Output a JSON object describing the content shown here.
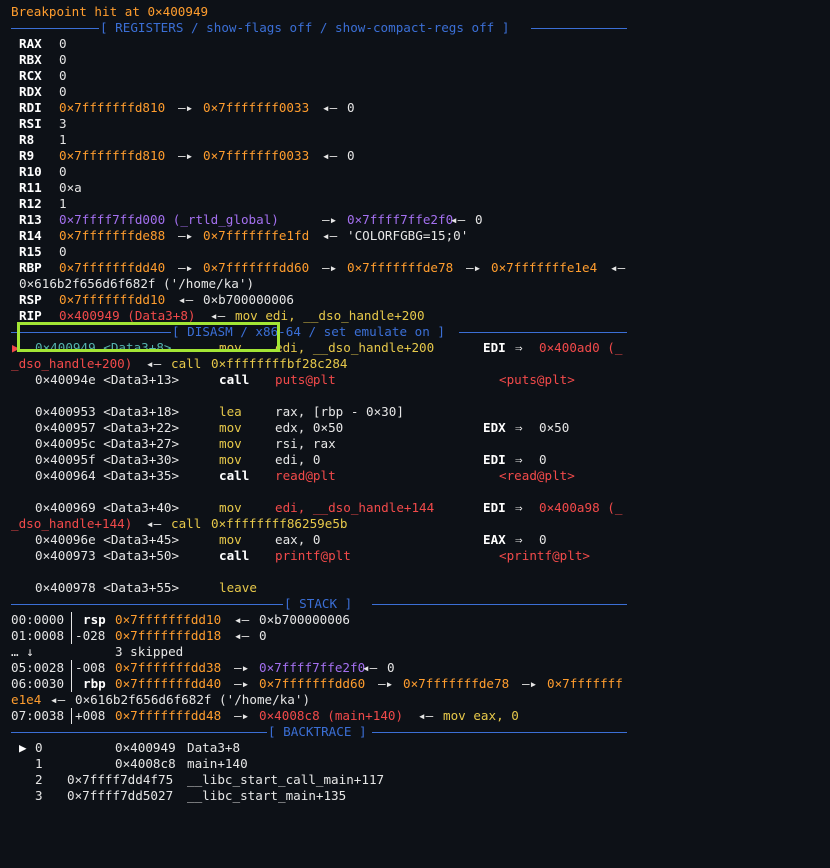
{
  "breakpoint": "Breakpoint hit at 0×400949",
  "sections": {
    "registers": "[ REGISTERS / show-flags off / show-compact-regs off ]",
    "disasm": "[ DISASM / x86-64 / set emulate on ]",
    "stack": "[ STACK ]",
    "backtrace": "[ BACKTRACE ]"
  },
  "registers": [
    {
      "name": "RAX",
      "val": "0"
    },
    {
      "name": "RBX",
      "val": "0"
    },
    {
      "name": "RCX",
      "val": "0"
    },
    {
      "name": "RDX",
      "val": "0"
    },
    {
      "name": "RDI",
      "addr": "0×7fffffffd810",
      "arrow": "—▸",
      "target": "0×7fffffff0033",
      "larrow": "◂—",
      "deref": "0"
    },
    {
      "name": "RSI",
      "val": "3"
    },
    {
      "name": "R8",
      "val": "1"
    },
    {
      "name": "R9",
      "addr": "0×7fffffffd810",
      "arrow": "—▸",
      "target": "0×7fffffff0033",
      "larrow": "◂—",
      "deref": "0"
    },
    {
      "name": "R10",
      "val": "0"
    },
    {
      "name": "R11",
      "val": "0×a"
    },
    {
      "name": "R12",
      "val": "1"
    },
    {
      "name": "R13",
      "addr": "0×7ffff7ffd000 (_rtld_global)",
      "arrow": "—▸",
      "target": "0×7ffff7ffe2f0",
      "larrow": "◂—",
      "deref": "0"
    },
    {
      "name": "R14",
      "addr": "0×7fffffffde88",
      "arrow": "—▸",
      "target": "0×7fffffffe1fd",
      "larrow": "◂—",
      "deref": "'COLORFGBG=15;0'"
    },
    {
      "name": "R15",
      "val": "0"
    },
    {
      "name": "RBP",
      "addr": "0×7fffffffdd40",
      "a1": "—▸",
      "t1": "0×7fffffffdd60",
      "a2": "—▸",
      "t2": "0×7fffffffde78",
      "a3": "—▸",
      "t3": "0×7fffffffe1e4",
      "a4": "◂—",
      "cont": "0×616b2f656d6f682f ('/home/ka')"
    },
    {
      "name": "RSP",
      "addr": "0×7fffffffdd10",
      "larrow": "◂—",
      "deref": "0×b700000006"
    },
    {
      "name": "RIP",
      "addr": "0×400949 (Data3+8)",
      "larrow": "◂—",
      "instr": "mov edi, __dso_handle+200"
    }
  ],
  "disasm": {
    "current": {
      "marker": "▶",
      "addr": "0×400949 <Data3+8>",
      "mnem": "mov",
      "ops": "edi, __dso_handle+200",
      "reg": "EDI",
      "arrow": "⇒",
      "res": "0×400ad0 (_",
      "cont": "_dso_handle+200)",
      "carrow": "◂—",
      "ccall": "call",
      "ctarget": "0×ffffffffbf28c284"
    },
    "rows": [
      {
        "addr": "0×40094e <Data3+13>",
        "mnem": "call",
        "ops": "puts@plt",
        "comment": "<puts@plt>"
      },
      {
        "addr": "0×400953 <Data3+18>",
        "mnem": "lea",
        "ops": "rax, [rbp - 0×30]"
      },
      {
        "addr": "0×400957 <Data3+22>",
        "mnem": "mov",
        "ops": "edx, 0×50",
        "reg": "EDX",
        "arrow": "⇒",
        "res": "0×50"
      },
      {
        "addr": "0×40095c <Data3+27>",
        "mnem": "mov",
        "ops": "rsi, rax"
      },
      {
        "addr": "0×40095f <Data3+30>",
        "mnem": "mov",
        "ops": "edi, 0",
        "reg": "EDI",
        "arrow": "⇒",
        "res": "0"
      },
      {
        "addr": "0×400964 <Data3+35>",
        "mnem": "call",
        "ops": "read@plt",
        "comment": "<read@plt>"
      },
      {
        "addr": "0×400969 <Data3+40>",
        "mnem": "mov",
        "ops": "edi, __dso_handle+144",
        "reg": "EDI",
        "arrow": "⇒",
        "res": "0×400a98 (_",
        "cont": "_dso_handle+144)",
        "carrow": "◂—",
        "ccall": "call",
        "ctarget": "0×ffffffff86259e5b"
      },
      {
        "addr": "0×40096e <Data3+45>",
        "mnem": "mov",
        "ops": "eax, 0",
        "reg": "EAX",
        "arrow": "⇒",
        "res": "0"
      },
      {
        "addr": "0×400973 <Data3+50>",
        "mnem": "call",
        "ops": "printf@plt",
        "comment": "<printf@plt>"
      },
      {
        "addr": "0×400978 <Data3+55>",
        "mnem": "leave",
        "ops": ""
      }
    ]
  },
  "stack": [
    {
      "idx": "00:0000",
      "reg": "rsp",
      "addr": "0×7fffffffdd10",
      "larrow": "◂—",
      "val": "0×b700000006"
    },
    {
      "idx": "01:0008",
      "off": "-028",
      "addr": "0×7fffffffdd18",
      "larrow": "◂—",
      "val": "0"
    },
    {
      "dots": "… ↓",
      "skip": "3 skipped"
    },
    {
      "idx": "05:0028",
      "off": "-008",
      "addr": "0×7fffffffdd38",
      "arrow": "—▸",
      "target": "0×7ffff7ffe2f0",
      "larrow": "◂—",
      "val": "0"
    },
    {
      "idx": "06:0030",
      "reg": "rbp",
      "addr": "0×7fffffffdd40",
      "a1": "—▸",
      "t1": "0×7fffffffdd60",
      "a2": "—▸",
      "t2": "0×7fffffffde78",
      "a3": "—▸",
      "t3": "0×7fffffff",
      "cont_t": "e1e4",
      "cont_arrow": "◂—",
      "cont_val": "0×616b2f656d6f682f ('/home/ka')"
    },
    {
      "idx": "07:0038",
      "off": "+008",
      "addr": "0×7fffffffdd48",
      "arrow": "—▸",
      "target": "0×4008c8 (main+140)",
      "larrow": "◂—",
      "instr": "mov eax, 0"
    }
  ],
  "backtrace": [
    {
      "marker": "▶",
      "n": "0",
      "addr": "0×400949",
      "sym": "Data3+8"
    },
    {
      "n": "1",
      "addr": "0×4008c8",
      "sym": "main+140"
    },
    {
      "n": "2",
      "addr": "0×7ffff7dd4f75",
      "sym": "__libc_start_call_main+117"
    },
    {
      "n": "3",
      "addr": "0×7ffff7dd5027",
      "sym": "__libc_start_main+135"
    }
  ],
  "colors": {
    "background": "#0d1117",
    "addr": "#ff9d2e",
    "libaddr": "#a470f0",
    "code": "#f24a4a",
    "mnem": "#e6c84a",
    "heading": "#3b6fd6",
    "highlight": "#a3e635"
  }
}
